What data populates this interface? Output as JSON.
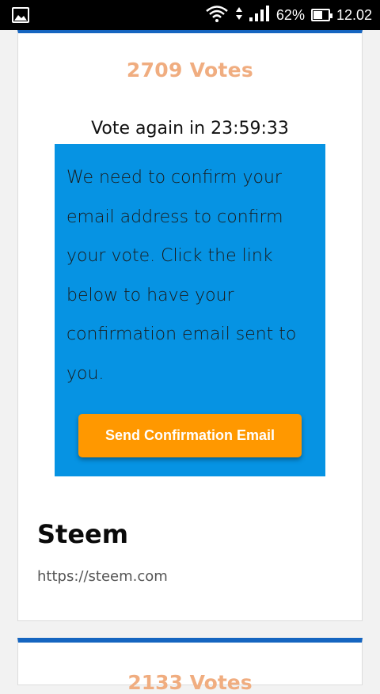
{
  "status_bar": {
    "battery_percent": "62%",
    "battery_level": 0.62,
    "time": "12.02"
  },
  "poll_card": {
    "votes": "2709 Votes",
    "vote_again": "Vote again in 23:59:33",
    "confirm_message": "We need to confirm your email address to confirm your vote. Click the link below to have your confirmation email sent to you.",
    "send_button_label": "Send Confirmation Email",
    "site_name": "Steem",
    "site_url": "https://steem.com"
  },
  "next_card": {
    "votes_partial": "2133 Votes"
  },
  "colors": {
    "card_top_border": "#1565c0",
    "votes_text": "#f0ad80",
    "confirm_box": "#0693e3",
    "button": "#ff9800"
  }
}
